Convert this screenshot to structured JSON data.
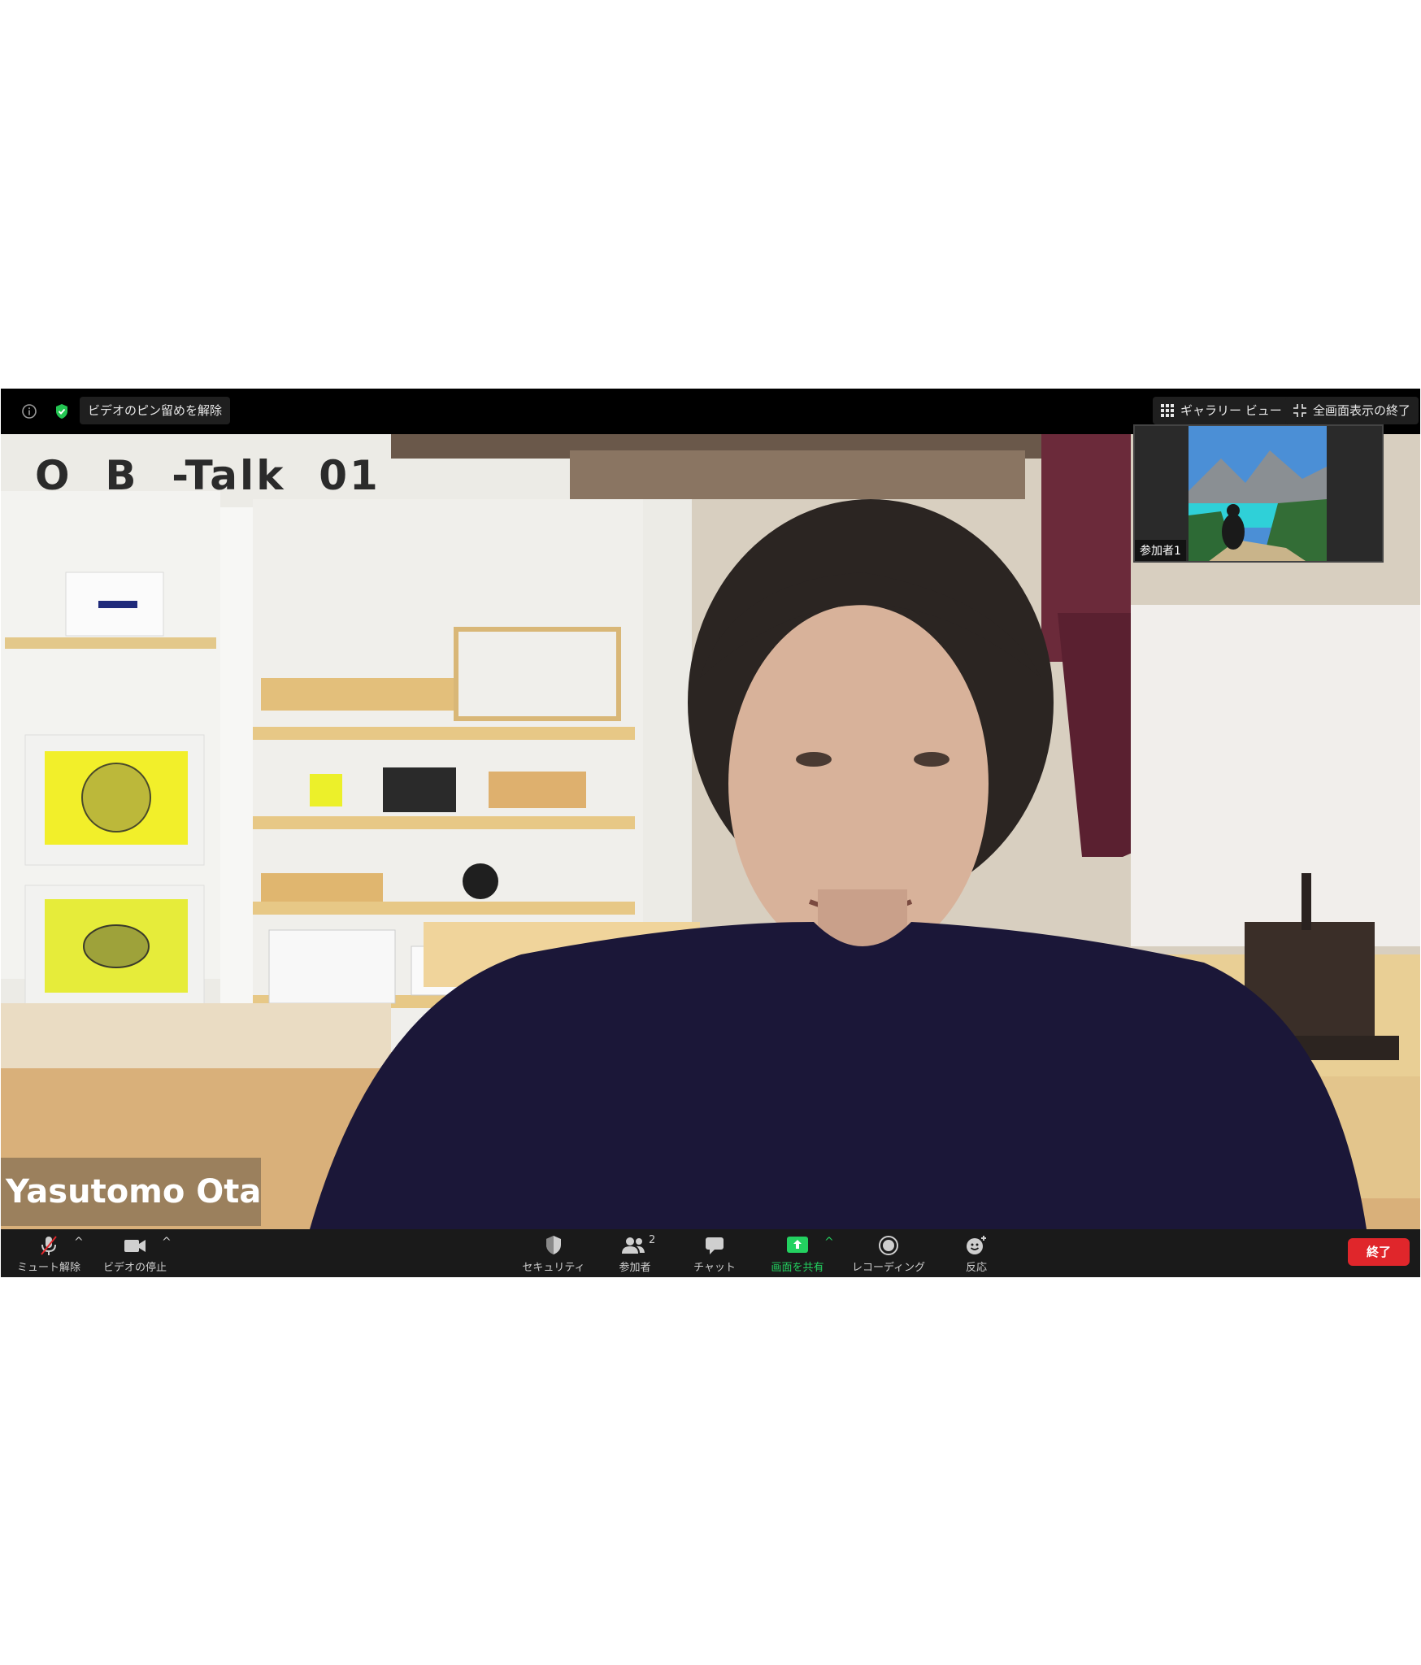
{
  "topbar": {
    "info_icon": "info-icon",
    "security_icon": "shield-check-icon",
    "unpin_label": "ビデオのピン留めを解除",
    "gallery_label": "ギャラリー ビュー",
    "exit_fullscreen_label": "全画面表示の終了"
  },
  "video": {
    "overlay_text": "O  B  -Talk  01",
    "speaker_name": "Yasutomo Ota"
  },
  "thumbnail": {
    "label": "参加者1"
  },
  "toolbar": {
    "mute_label": "ミュート解除",
    "video_label": "ビデオの停止",
    "security_label": "セキュリティ",
    "participants_label": "参加者",
    "participants_count": "2",
    "chat_label": "チャット",
    "share_label": "画面を共有",
    "record_label": "レコーディング",
    "reactions_label": "反応",
    "end_label": "終了",
    "caret": "^"
  },
  "colors": {
    "share_green": "#23d160",
    "end_red": "#e0262b",
    "toolbar_bg": "#1a1a1a"
  }
}
